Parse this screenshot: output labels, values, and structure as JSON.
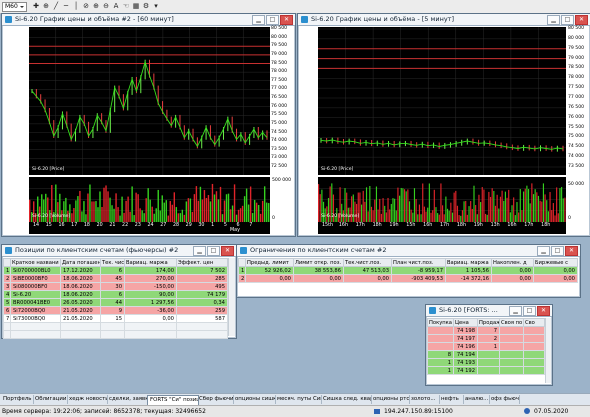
{
  "toolbar": {
    "instrument_select": "M60"
  },
  "chart1": {
    "title": "Si-6.20 График цены и объёма #2 - [60 минут]",
    "price_label": "Si-6.20 [Price]",
    "volume_label": "Si-6.20 [Volume]",
    "price_axis": [
      "80 500",
      "80 000",
      "79 500",
      "79 000",
      "78 500",
      "78 000",
      "77 500",
      "77 000",
      "76 500",
      "76 000",
      "75 500",
      "75 000",
      "74 500",
      "74 000",
      "73 500",
      "73 000",
      "72 500"
    ],
    "volume_axis": [
      "500 000",
      "0"
    ],
    "x_ticks": [
      "14",
      "15",
      "16",
      "17",
      "18",
      "20",
      "21",
      "22",
      "23",
      "24",
      "27",
      "28",
      "29",
      "30",
      "1",
      "5",
      "6",
      "7"
    ],
    "x_month": "May",
    "price_series": [
      76900,
      76600,
      76300,
      75800,
      75100,
      74300,
      74800,
      75600,
      74900,
      74100,
      74600,
      75400,
      75000,
      74300,
      74700,
      75500,
      75100,
      74600,
      75800,
      77100,
      76600,
      75900,
      76800,
      77600,
      76900,
      77700,
      78600,
      77800,
      77100,
      76200,
      75700,
      75300,
      74900,
      75400,
      74800,
      74200,
      74600,
      74100,
      73700,
      74200,
      74800,
      74200,
      73800,
      74200,
      74700,
      75300,
      74600,
      74100,
      74400,
      73900,
      74300,
      74700,
      74200,
      74500,
      74200
    ]
  },
  "chart2": {
    "title": "Si-6.20 График цены и объёма - [5 минут]",
    "price_label": "Si-6.20 [Price]",
    "volume_label": "Si-6.20 [Volume]",
    "price_axis": [
      "80 500",
      "80 000",
      "79 500",
      "79 000",
      "78 500",
      "78 000",
      "77 500",
      "77 000",
      "76 500",
      "76 000",
      "75 500",
      "75 000",
      "74 500",
      "74 000",
      "73 500"
    ],
    "volume_axis": [
      "50 000",
      "0"
    ],
    "x_ticks": [
      "15th",
      "16h",
      "17h",
      "18h",
      "19h",
      "15h",
      "16h",
      "17h",
      "18h",
      "19h",
      "13h",
      "16h",
      "17h",
      "18h"
    ],
    "price_series": [
      74850,
      74820,
      74870,
      74800,
      74760,
      74820,
      74780,
      74700,
      74750,
      74680,
      74720,
      74650,
      74700,
      74620,
      74680,
      74700,
      74640,
      74600,
      74660,
      74580,
      74620,
      74540,
      74600,
      74640,
      74700,
      74760,
      74820,
      74760,
      74700,
      74720,
      74680,
      74620,
      74580,
      74520,
      74480,
      74440,
      74500,
      74460,
      74420,
      74480,
      74440,
      74400,
      74460,
      74420
    ]
  },
  "positions": {
    "title": "Позиции по клиентским счетам (фьючерсы) #2",
    "columns": [
      "",
      "Краткое названи",
      "Дата погашен",
      "Тек. чист",
      "Вариац. маржа",
      "Эффект. цен"
    ],
    "rows": [
      {
        "n": "1",
        "name": "Si0700000BL0",
        "date": "17.12.2020",
        "qty": "6",
        "var": "174,00",
        "eff": "7 502",
        "style": "g"
      },
      {
        "n": "2",
        "name": "SiBE0000BF0",
        "date": "18.06.2020",
        "qty": "45",
        "var": "270,00",
        "eff": "285",
        "style": "r"
      },
      {
        "n": "3",
        "name": "Si080000BF0",
        "date": "18.06.2020",
        "qty": "30",
        "var": "-150,00",
        "eff": "495",
        "style": "r"
      },
      {
        "n": "4",
        "name": "Si-6.20",
        "date": "18.06.2020",
        "qty": "6",
        "var": "90,00",
        "eff": "74 179",
        "style": "g"
      },
      {
        "n": "5",
        "name": "BR000041BE0",
        "date": "26.05.2020",
        "qty": "44",
        "var": "1 297,56",
        "eff": "0,34",
        "style": "g"
      },
      {
        "n": "6",
        "name": "Si72000BQ0",
        "date": "21.05.2020",
        "qty": "9",
        "var": "-36,00",
        "eff": "259",
        "style": "r"
      },
      {
        "n": "7",
        "name": "Si73000BQ0",
        "date": "21.05.2020",
        "qty": "15",
        "var": "0,00",
        "eff": "587",
        "style": "w"
      }
    ]
  },
  "limits": {
    "title": "Ограничения по клиентским счетам #2",
    "columns": [
      "",
      "Предыд. лимит",
      "Лимит откр. поз.",
      "Тек.чист.поз.",
      "План чист.поз.",
      "Вариац. маржа",
      "Накоплен. д",
      "Биржевые с"
    ],
    "rows": [
      {
        "n": "1",
        "prev": "52 926,02",
        "lim": "38 553,86",
        "cur": "47 513,03",
        "plan": "-8 959,17",
        "var": "1 105,56",
        "acc": "0,00",
        "fee": "0,00",
        "style": "g"
      },
      {
        "n": "2",
        "prev": "0,00",
        "lim": "0,00",
        "cur": "0,00",
        "plan": "-903 409,53",
        "var": "-14 372,16",
        "acc": "0,00",
        "fee": "0,00",
        "style": "r"
      }
    ]
  },
  "orderbook": {
    "title": "Si-6.20 [FORTS: ...",
    "columns": [
      "Покупка",
      "Цена",
      "Продажа",
      "Своя по",
      "Сво"
    ],
    "rows": [
      {
        "buy": "",
        "price": "74 198",
        "sell": "7",
        "style": "r"
      },
      {
        "buy": "",
        "price": "74 197",
        "sell": "2",
        "style": "r"
      },
      {
        "buy": "",
        "price": "74 196",
        "sell": "1",
        "style": "r"
      },
      {
        "buy": "8",
        "price": "74 194",
        "sell": "",
        "style": "g"
      },
      {
        "buy": "1",
        "price": "74 193",
        "sell": "",
        "style": "g"
      },
      {
        "buy": "1",
        "price": "74 192",
        "sell": "",
        "style": "g"
      }
    ]
  },
  "tabs": [
    "Портфель",
    "Облигации",
    "хедж новости",
    "сделки, заявки",
    "FORTS \"Си\" позици",
    "Сбер фьючи",
    "опционы сишка",
    "месяч. путы Сишка",
    "Сишка след. квартал",
    "опционы ртс",
    "золото...",
    "нефть",
    "аналю...",
    "офз фьючи"
  ],
  "status": {
    "left": "Время сервера: 19:22:06; записей: 8652378; текущая: 32496652",
    "connection": "194.247.150.89:15100",
    "date": "07.05.2020"
  },
  "colors": {
    "price_line": "#34e01a",
    "volume_bar": "#e0242a",
    "volume_bar2": "#35d01f",
    "hline": "#c83030",
    "grid": "#2a2a2a"
  }
}
